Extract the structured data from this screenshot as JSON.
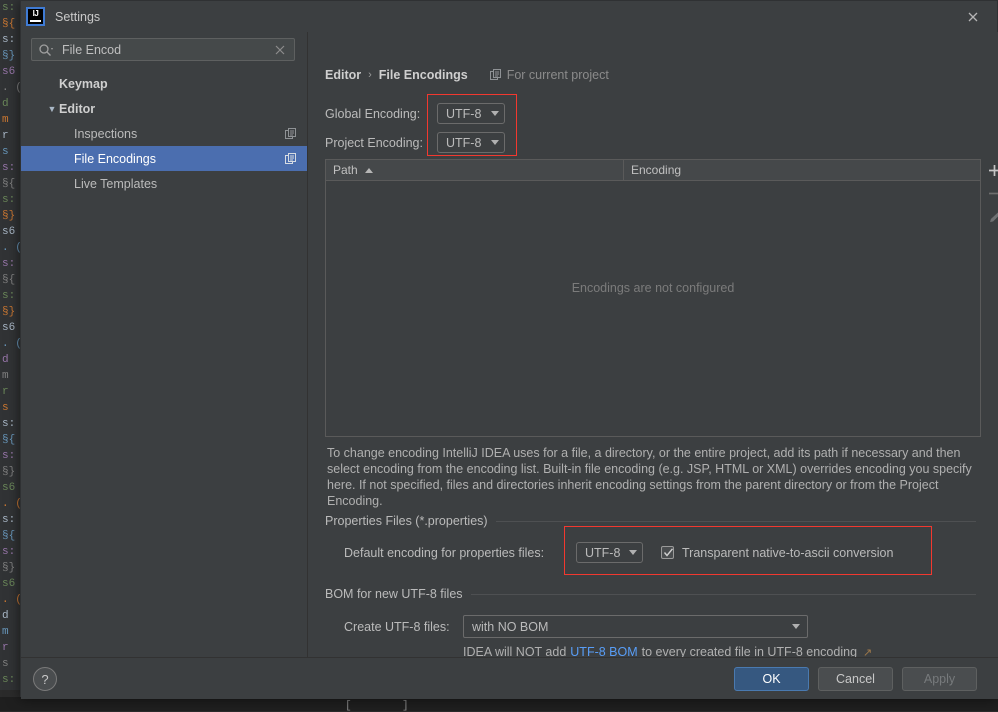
{
  "window": {
    "title": "Settings",
    "logo_icon": "intellij-idea-logo",
    "close_icon": "close-icon"
  },
  "sidebar": {
    "search": {
      "value": "File Encod",
      "placeholder": "",
      "icon": "search-icon",
      "clear_icon": "clear-icon"
    },
    "items": [
      {
        "label": "Keymap",
        "level": 0,
        "bold": true,
        "expander": "",
        "badge": ""
      },
      {
        "label": "Editor",
        "level": 0,
        "bold": true,
        "expander": "▼",
        "badge": ""
      },
      {
        "label": "Inspections",
        "level": 1,
        "bold": false,
        "expander": "",
        "badge": "copy-icon"
      },
      {
        "label": "File Encodings",
        "level": 1,
        "bold": false,
        "expander": "",
        "badge": "copy-icon"
      },
      {
        "label": "Live Templates",
        "level": 1,
        "bold": false,
        "expander": "",
        "badge": ""
      }
    ],
    "selected_index": 3
  },
  "main": {
    "breadcrumb": {
      "parent": "Editor",
      "separator": "›",
      "current": "File Encodings"
    },
    "scope_tag": {
      "label": "For current project",
      "icon": "copy-icon"
    },
    "global_encoding": {
      "label": "Global Encoding:",
      "value": "UTF-8"
    },
    "project_encoding": {
      "label": "Project Encoding:",
      "value": "UTF-8"
    },
    "table": {
      "columns": [
        "Path",
        "Encoding"
      ],
      "sort_column": "Path",
      "sort_direction": "asc",
      "rows": [],
      "empty_message": "Encodings are not configured",
      "toolbar": [
        {
          "name": "add-icon",
          "glyph": "+"
        },
        {
          "name": "remove-icon",
          "glyph": "−"
        },
        {
          "name": "edit-icon",
          "glyph": "✎"
        }
      ]
    },
    "description": "To change encoding IntelliJ IDEA uses for a file, a directory, or the entire project, add its path if necessary and then select encoding from the encoding list. Built-in file encoding (e.g. JSP, HTML or XML) overrides encoding you specify here. If not specified, files and directories inherit encoding settings from the parent directory or from the Project Encoding.",
    "properties_section": {
      "title": "Properties Files (*.properties)",
      "default_encoding_label": "Default encoding for properties files:",
      "default_encoding_value": "UTF-8",
      "transparent_conversion_label": "Transparent native-to-ascii conversion",
      "transparent_conversion_checked": true
    },
    "bom_section": {
      "title": "BOM for new UTF-8 files",
      "create_label": "Create UTF-8 files:",
      "create_value": "with NO BOM",
      "hint_prefix": "IDEA will NOT add",
      "hint_link": "UTF-8 BOM",
      "hint_suffix": "to every created file in UTF-8 encoding",
      "hint_external_icon": "↗"
    }
  },
  "footer": {
    "help_label": "?",
    "ok_label": "OK",
    "cancel_label": "Cancel",
    "apply_label": "Apply"
  },
  "colors": {
    "dialog_bg": "#3c3f41",
    "selection_blue": "#4b6eaf",
    "primary_button": "#365880",
    "highlight_red": "#f2382f",
    "link_blue": "#589df6"
  },
  "background_editor": {
    "gutter_lines": [
      "s:",
      "§{",
      "s:",
      "§}",
      "s6",
      ". (",
      "d",
      "m",
      "r",
      "s",
      "s:",
      "§{",
      "s:",
      "§}",
      "s6",
      ". ("
    ]
  }
}
